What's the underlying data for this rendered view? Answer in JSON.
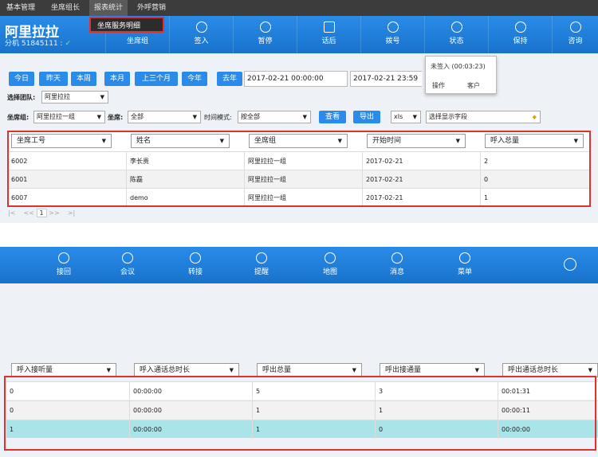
{
  "menu": {
    "items": [
      "基本管理",
      "坐席组长",
      "报表统计",
      "外呼营销"
    ],
    "dropdown_item": "坐席服务明细"
  },
  "header": {
    "brand": "阿里拉拉",
    "extension": "分机 51845111 :",
    "ext_ok": "✓",
    "nav": [
      "坐席组",
      "签入",
      "暂停",
      "话后",
      "拨号",
      "状态",
      "保持",
      "咨询"
    ]
  },
  "status_popup": {
    "state": "未签入 (00:03:23)",
    "action1": "操作",
    "action2": "客户"
  },
  "filters": {
    "quick": [
      "今日",
      "昨天",
      "本周",
      "本月",
      "上三个月",
      "今年",
      "去年"
    ],
    "start_time": "2017-02-21 00:00:00",
    "end_time": "2017-02-21 23:59",
    "team_label": "选择团队:",
    "team_value": "阿里拉拉",
    "group_label": "坐席组:",
    "group_value": "阿里拉拉一组",
    "agent_label": "坐席:",
    "agent_value": "全部",
    "timemode_label": "时间模式:",
    "timemode_value": "按全部",
    "search_btn": "查看",
    "export_btn": "导出",
    "format_value": "xls",
    "fields_value": "选择显示字段"
  },
  "table1": {
    "headers": [
      "坐席工号",
      "姓名",
      "坐席组",
      "开始时间",
      "呼入总量"
    ],
    "rows": [
      [
        "6002",
        "李长贵",
        "阿里拉拉一组",
        "2017-02-21",
        "2"
      ],
      [
        "6001",
        "陈磊",
        "阿里拉拉一组",
        "2017-02-21",
        "0"
      ],
      [
        "6007",
        "demo",
        "阿里拉拉一组",
        "2017-02-21",
        "1"
      ]
    ]
  },
  "pager": {
    "first": "|<",
    "prev": "<<",
    "page": "1",
    "next": ">>",
    "last": ">|"
  },
  "nav2": [
    "接回",
    "会议",
    "转接",
    "提醒",
    "地图",
    "消息",
    "菜单"
  ],
  "table2": {
    "headers": [
      "呼入接听量",
      "呼入通话总时长",
      "呼出总量",
      "呼出接通量",
      "呼出通话总时长"
    ],
    "rows": [
      [
        "0",
        "00:00:00",
        "5",
        "3",
        "00:01:31"
      ],
      [
        "0",
        "00:00:00",
        "1",
        "1",
        "00:00:11"
      ],
      [
        "1",
        "00:00:00",
        "1",
        "0",
        "00:00:00"
      ]
    ]
  }
}
